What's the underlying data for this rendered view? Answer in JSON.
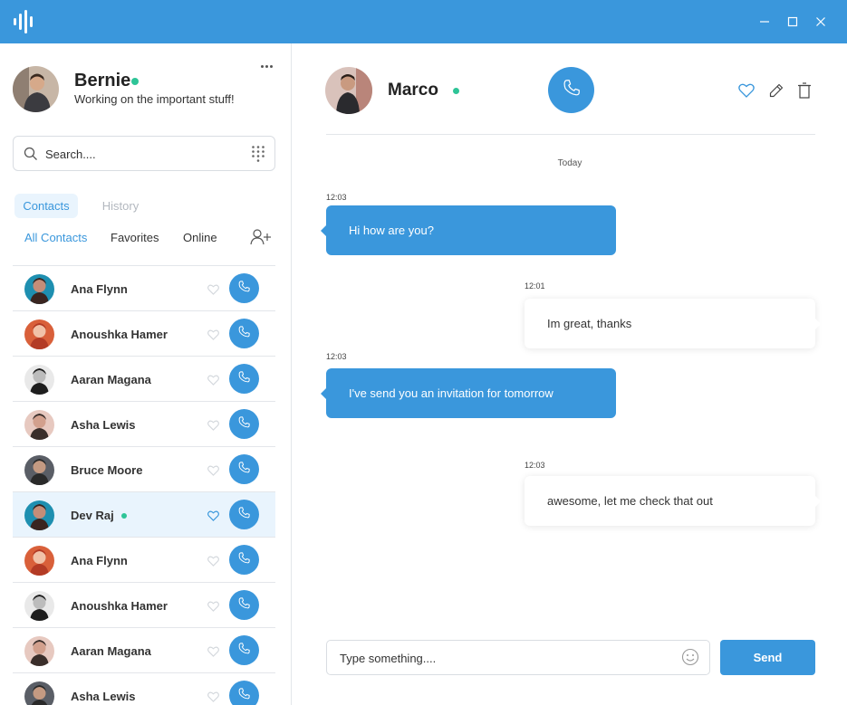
{
  "app": {
    "logo_icon": "voice-wave-icon",
    "window_controls": [
      "minimize-icon",
      "maximize-icon",
      "close-icon"
    ]
  },
  "profile": {
    "name": "Bernie",
    "status_text": "Working on the important stuff!",
    "online": true,
    "more_icon": "ellipsis-icon"
  },
  "search": {
    "placeholder": "Search....",
    "icon": "search-icon",
    "dialpad_icon": "dialpad-icon"
  },
  "tabs": [
    {
      "label": "Contacts",
      "active": true
    },
    {
      "label": "History",
      "active": false
    }
  ],
  "filters": [
    {
      "label": "All Contacts",
      "active": true
    },
    {
      "label": "Favorites",
      "active": false
    },
    {
      "label": "Online",
      "active": false
    }
  ],
  "add_contact_icon": "add-user-icon",
  "contacts": [
    {
      "name": "Ana Flynn",
      "online": false,
      "selected": false
    },
    {
      "name": "Anoushka Hamer",
      "online": false,
      "selected": false
    },
    {
      "name": "Aaran Magana",
      "online": false,
      "selected": false
    },
    {
      "name": "Asha Lewis",
      "online": false,
      "selected": false
    },
    {
      "name": "Bruce Moore",
      "online": false,
      "selected": false
    },
    {
      "name": "Dev Raj",
      "online": true,
      "selected": true
    },
    {
      "name": "Ana Flynn",
      "online": false,
      "selected": false
    },
    {
      "name": "Anoushka Hamer",
      "online": false,
      "selected": false
    },
    {
      "name": "Aaran Magana",
      "online": false,
      "selected": false
    },
    {
      "name": "Asha Lewis",
      "online": false,
      "selected": false
    }
  ],
  "chat": {
    "contact_name": "Marco",
    "online": true,
    "actions": [
      "heart-icon",
      "edit-icon",
      "trash-icon"
    ],
    "call_icon": "phone-icon",
    "day_label": "Today",
    "messages": [
      {
        "time": "12:03",
        "text": "Hi how are you?",
        "direction": "in"
      },
      {
        "time": "12:01",
        "text": "Im great, thanks",
        "direction": "out"
      },
      {
        "time": "12:03",
        "text": "I've send you an invitation for tomorrow",
        "direction": "in"
      },
      {
        "time": "12:03",
        "text": "awesome, let me check that out",
        "direction": "out"
      }
    ],
    "composer_placeholder": "Type something....",
    "emoji_icon": "emoji-icon",
    "send_label": "Send"
  },
  "colors": {
    "accent": "#3a97dc",
    "online": "#2ec497",
    "selected_row": "#e9f4fd"
  }
}
